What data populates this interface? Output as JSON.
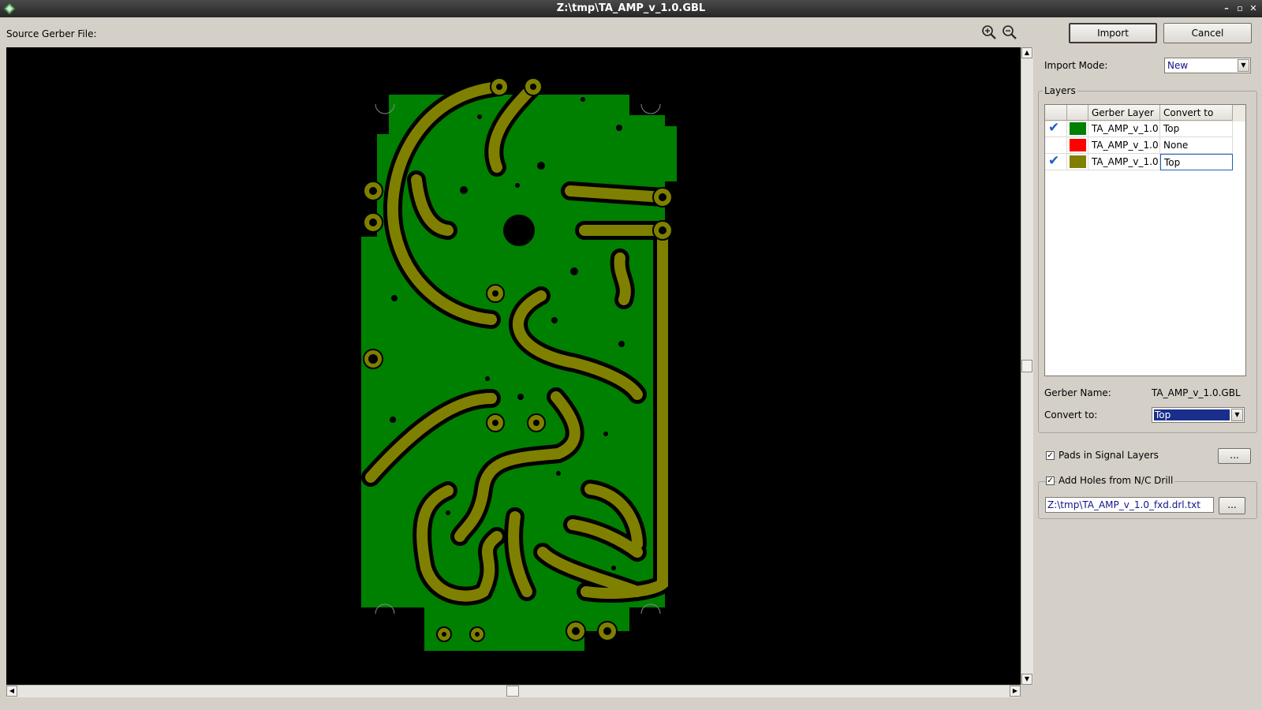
{
  "window": {
    "title": "Z:\\tmp\\TA_AMP_v_1.0.GBL",
    "controls": [
      "–",
      "▫",
      "✕"
    ]
  },
  "source": {
    "label": "Source Gerber File:"
  },
  "zoom": {
    "in_icon": "zoom-in-icon",
    "out_icon": "zoom-out-icon"
  },
  "buttons": {
    "import": "Import",
    "cancel": "Cancel"
  },
  "import_mode": {
    "label": "Import Mode:",
    "value": "New"
  },
  "layers": {
    "group_label": "Layers",
    "columns": [
      "",
      "",
      "Gerber Layer",
      "Convert to"
    ],
    "rows": [
      {
        "checked": true,
        "color": "#008000",
        "gerber_layer": "TA_AMP_v_1.0.",
        "convert_to": "Top"
      },
      {
        "checked": false,
        "color": "#ff0000",
        "gerber_layer": "TA_AMP_v_1.0.",
        "convert_to": "None"
      },
      {
        "checked": true,
        "color": "#808000",
        "gerber_layer": "TA_AMP_v_1.0.",
        "convert_to": "Top"
      }
    ],
    "gerber_name_label": "Gerber Name:",
    "gerber_name_value": "TA_AMP_v_1.0.GBL",
    "convert_to_label": "Convert to:",
    "convert_to_value": "Top"
  },
  "options": {
    "pads_label": "Pads in Signal Layers",
    "pads_checked": true,
    "pads_button": "...",
    "holes_label": "Add Holes from N/C Drill",
    "holes_checked": true,
    "drill_path": "Z:\\tmp\\TA_AMP_v_1.0_fxd.drl.txt",
    "drill_button": "..."
  },
  "colors": {
    "copper_fill": "#008000",
    "traces": "#808000",
    "background": "#000000"
  }
}
